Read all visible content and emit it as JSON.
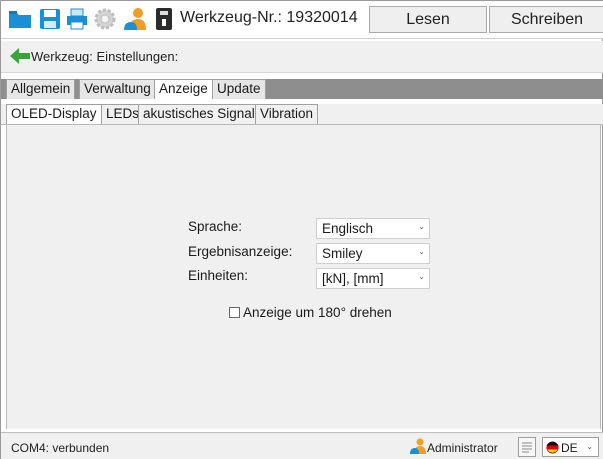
{
  "toolbar": {
    "icons": [
      "folder-icon",
      "save-icon",
      "print-icon",
      "settings-gear-icon",
      "user-icon",
      "usb-device-icon"
    ],
    "tool_label": "Werkzeug-Nr.: 19320014",
    "read_button": "Lesen",
    "write_button": "Schreiben"
  },
  "breadcrumb": {
    "text": "Werkzeug: Einstellungen:"
  },
  "tabs_main": [
    {
      "label": "Allgemein",
      "active": false
    },
    {
      "label": "Verwaltung",
      "active": false
    },
    {
      "label": "Anzeige",
      "active": true
    },
    {
      "label": "Update",
      "active": false
    }
  ],
  "tabs_sub": [
    {
      "label": "OLED-Display",
      "active": true
    },
    {
      "label": "LEDs",
      "active": false
    },
    {
      "label": "akustisches Signal",
      "active": false
    },
    {
      "label": "Vibration",
      "active": false
    }
  ],
  "form": {
    "language": {
      "label": "Sprache:",
      "value": "Englisch"
    },
    "result_display": {
      "label": "Ergebnisanzeige:",
      "value": "Smiley"
    },
    "units": {
      "label": "Einheiten:",
      "value": "[kN], [mm]"
    },
    "rotate": {
      "label": "Anzeige um 180° drehen",
      "checked": false
    }
  },
  "status": {
    "connection": "COM4: verbunden",
    "user": "Administrator",
    "language": "DE"
  },
  "colors": {
    "accent_blue": "#1a8fd6",
    "back_arrow_green": "#3aa33a",
    "user_orange": "#f0a020",
    "tab_strip": "#8e8e8e"
  }
}
